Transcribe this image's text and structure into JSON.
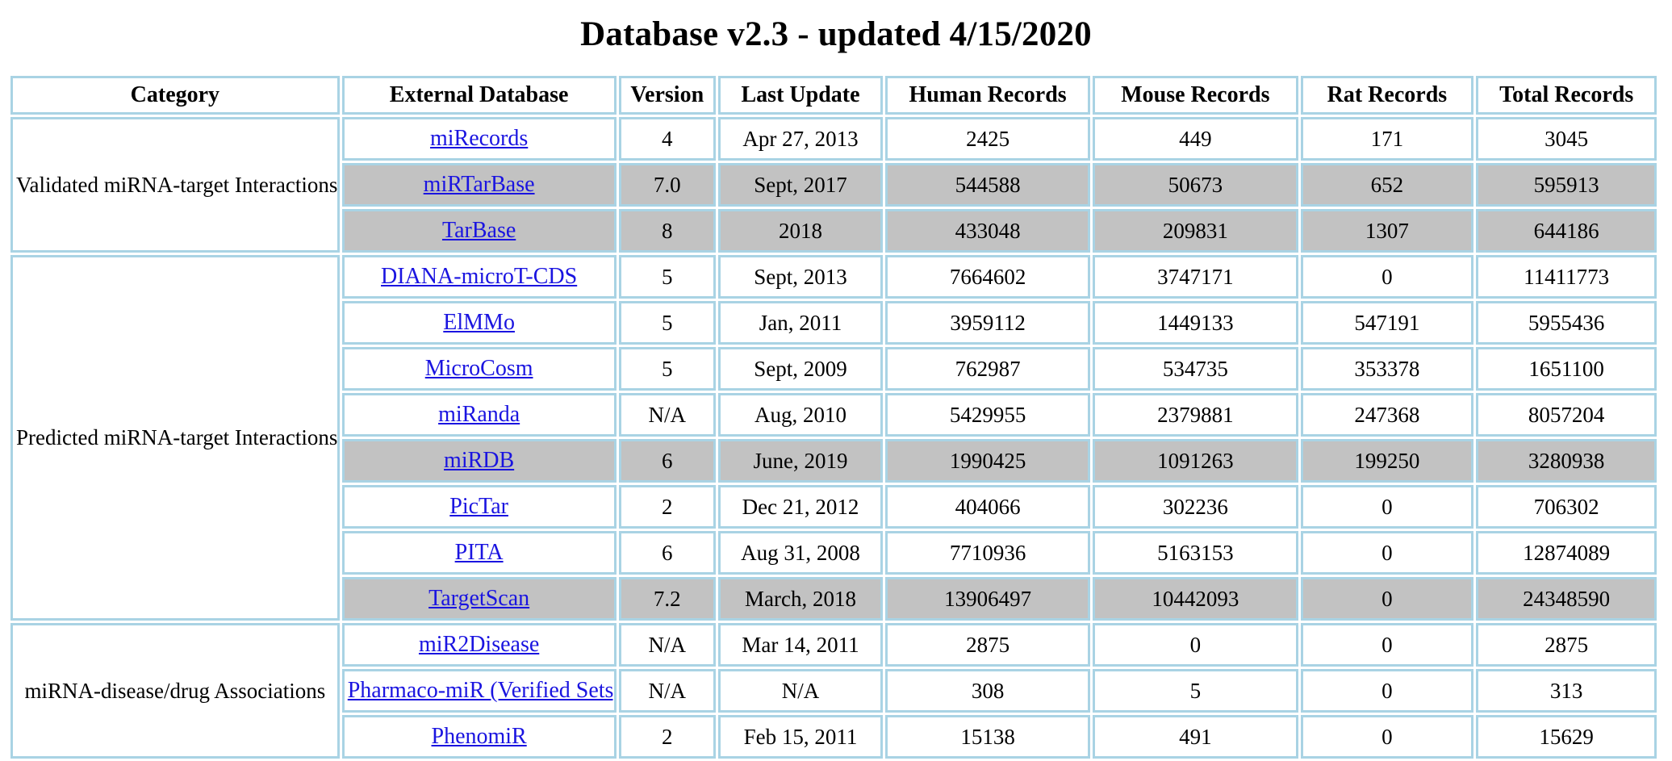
{
  "page": {
    "title": "Database v2.3 - updated 4/15/2020"
  },
  "table": {
    "headers": {
      "category": "Category",
      "external_database": "External Database",
      "version": "Version",
      "last_update": "Last Update",
      "human_records": "Human Records",
      "mouse_records": "Mouse Records",
      "rat_records": "Rat Records",
      "total_records": "Total Records"
    },
    "link_color": "#1a14e0",
    "border_color": "#a9d3e4",
    "shaded_row_color": "#c2c2c2",
    "categories": [
      {
        "name": "Validated miRNA-target Interactions",
        "rows": [
          {
            "database": "miRecords",
            "version": "4",
            "last_update": "Apr 27, 2013",
            "human": "2425",
            "mouse": "449",
            "rat": "171",
            "total": "3045",
            "shaded": false
          },
          {
            "database": "miRTarBase",
            "version": "7.0",
            "last_update": "Sept, 2017",
            "human": "544588",
            "mouse": "50673",
            "rat": "652",
            "total": "595913",
            "shaded": true
          },
          {
            "database": "TarBase",
            "version": "8",
            "last_update": "2018",
            "human": "433048",
            "mouse": "209831",
            "rat": "1307",
            "total": "644186",
            "shaded": true
          }
        ]
      },
      {
        "name": "Predicted miRNA-target Interactions",
        "rows": [
          {
            "database": "DIANA-microT-CDS",
            "version": "5",
            "last_update": "Sept, 2013",
            "human": "7664602",
            "mouse": "3747171",
            "rat": "0",
            "total": "11411773",
            "shaded": false
          },
          {
            "database": "ElMMo",
            "version": "5",
            "last_update": "Jan, 2011",
            "human": "3959112",
            "mouse": "1449133",
            "rat": "547191",
            "total": "5955436",
            "shaded": false
          },
          {
            "database": "MicroCosm",
            "version": "5",
            "last_update": "Sept, 2009",
            "human": "762987",
            "mouse": "534735",
            "rat": "353378",
            "total": "1651100",
            "shaded": false
          },
          {
            "database": "miRanda",
            "version": "N/A",
            "last_update": "Aug, 2010",
            "human": "5429955",
            "mouse": "2379881",
            "rat": "247368",
            "total": "8057204",
            "shaded": false
          },
          {
            "database": "miRDB",
            "version": "6",
            "last_update": "June, 2019",
            "human": "1990425",
            "mouse": "1091263",
            "rat": "199250",
            "total": "3280938",
            "shaded": true
          },
          {
            "database": "PicTar",
            "version": "2",
            "last_update": "Dec 21, 2012",
            "human": "404066",
            "mouse": "302236",
            "rat": "0",
            "total": "706302",
            "shaded": false
          },
          {
            "database": "PITA",
            "version": "6",
            "last_update": "Aug 31, 2008",
            "human": "7710936",
            "mouse": "5163153",
            "rat": "0",
            "total": "12874089",
            "shaded": false
          },
          {
            "database": "TargetScan",
            "version": "7.2",
            "last_update": "March, 2018",
            "human": "13906497",
            "mouse": "10442093",
            "rat": "0",
            "total": "24348590",
            "shaded": true
          }
        ]
      },
      {
        "name": "miRNA-disease/drug Associations",
        "rows": [
          {
            "database": "miR2Disease",
            "version": "N/A",
            "last_update": "Mar 14, 2011",
            "human": "2875",
            "mouse": "0",
            "rat": "0",
            "total": "2875",
            "shaded": false
          },
          {
            "database": "Pharmaco-miR (Verified Sets)",
            "version": "N/A",
            "last_update": "N/A",
            "human": "308",
            "mouse": "5",
            "rat": "0",
            "total": "313",
            "shaded": false
          },
          {
            "database": "PhenomiR",
            "version": "2",
            "last_update": "Feb 15, 2011",
            "human": "15138",
            "mouse": "491",
            "rat": "0",
            "total": "15629",
            "shaded": false
          }
        ]
      }
    ]
  }
}
